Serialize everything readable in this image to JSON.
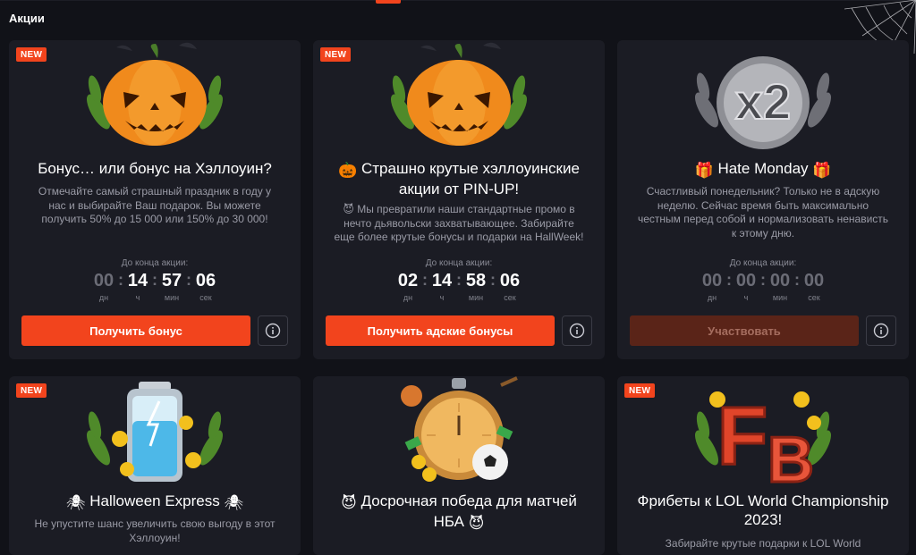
{
  "page": {
    "title": "Акции"
  },
  "colors": {
    "accent": "#f2441d",
    "card_bg": "#1b1c24",
    "page_bg": "#111218"
  },
  "cards": [
    {
      "badge": "NEW",
      "title": "Бонус… или бонус на Хэллоуин?",
      "description": "Отмечайте самый страшный праздник в году у нас и выбирайте Ваш подарок. Вы можете получить 50% до 15 000 или 150% до 30 000!",
      "countdown_label": "До конца акции:",
      "countdown": {
        "days": "00",
        "hours": "14",
        "minutes": "57",
        "seconds": "06"
      },
      "button": "Получить бонус",
      "icon": "pumpkin-icon"
    },
    {
      "badge": "NEW",
      "title": "Страшно крутые хэллоуинские акции от PIN-UP!",
      "title_emoji": "🎃",
      "description_emoji": "😈",
      "description": "Мы превратили наши стандартные промо в нечто дьявольски захватывающее. Забирайте еще более крутые бонусы и подарки на HallWeek!",
      "countdown_label": "До конца акции:",
      "countdown": {
        "days": "02",
        "hours": "14",
        "minutes": "58",
        "seconds": "06"
      },
      "button": "Получить адские бонусы",
      "icon": "pumpkin-icon"
    },
    {
      "title": "Hate Monday",
      "title_emoji": "🎁",
      "description": "Счастливый понедельник? Только не в адскую неделю. Сейчас время быть максимально честным перед собой и нормализовать ненависть к этому дню.",
      "countdown_label": "До конца акции:",
      "countdown": {
        "days": "00",
        "hours": "00",
        "minutes": "00",
        "seconds": "00"
      },
      "button": "Участвовать",
      "icon": "x2-icon"
    },
    {
      "badge": "NEW",
      "title": "Halloween Express",
      "title_emoji": "🕷",
      "description": "Не упустите шанс увеличить свою выгоду в этот Хэллоуин!",
      "icon": "battery-icon"
    },
    {
      "title": "Досрочная победа для матчей НБА",
      "title_emoji": "😈",
      "icon": "stopwatch-icon"
    },
    {
      "badge": "NEW",
      "title": "Фрибеты к LOL World Championship 2023!",
      "description": "Забирайте крутые подарки к LOL World",
      "icon": "fb-icon"
    }
  ],
  "countdown_units": {
    "days": "дн",
    "hours": "ч",
    "minutes": "мин",
    "seconds": "сек"
  }
}
